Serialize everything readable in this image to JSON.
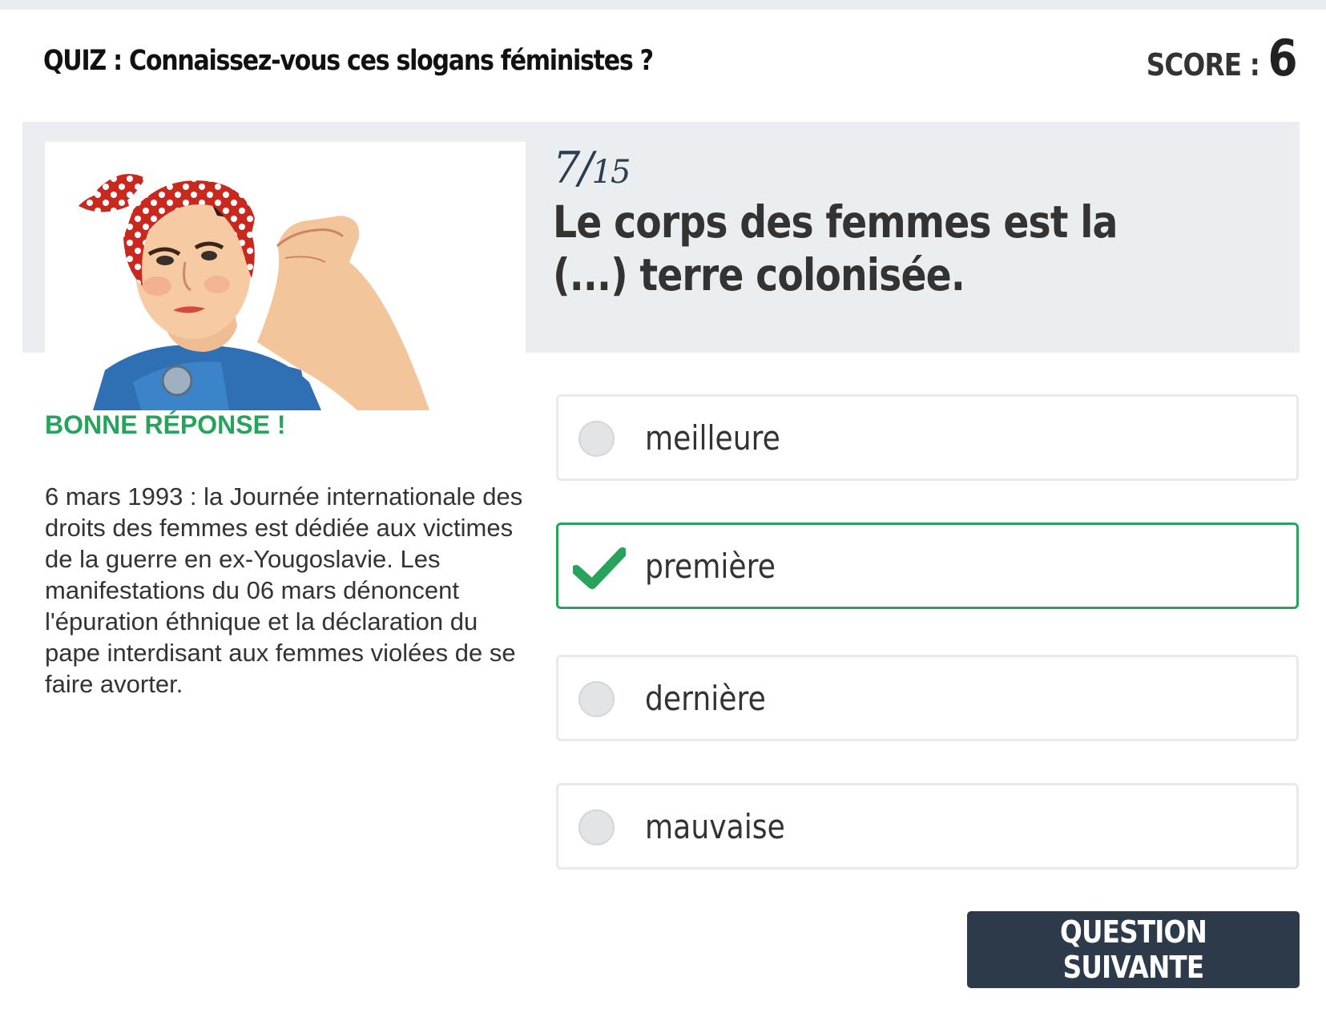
{
  "header": {
    "quiz_title": "QUIZ : Connaissez-vous ces slogans féministes ?",
    "score_label": "SCORE : ",
    "score_value": "6"
  },
  "question": {
    "counter_current": "7/",
    "counter_total": "15",
    "text": "Le corps des femmes est la (...) terre colonisée."
  },
  "image": {
    "subject": "Rosie the Riveter (We Can Do It!) illustration"
  },
  "feedback": {
    "verdict": "BONNE RÉPONSE !",
    "explanation": "6 mars 1993 : la Journée internationale des droits des femmes est dédiée aux victimes de la guerre en ex-Yougoslavie. Les manifestations du 06 mars dénoncent l'épuration éthnique et la déclaration du pape interdisant aux femmes violées de se faire avorter."
  },
  "options": [
    {
      "label": "meilleure",
      "state": "unselected"
    },
    {
      "label": "première",
      "state": "correct"
    },
    {
      "label": "dernière",
      "state": "unselected"
    },
    {
      "label": "mauvaise",
      "state": "unselected"
    }
  ],
  "actions": {
    "next_label": "QUESTION SUIVANTE"
  },
  "colors": {
    "correct": "#27a35c",
    "button_bg": "#2c3a4a",
    "band_bg": "#ebeef0"
  }
}
